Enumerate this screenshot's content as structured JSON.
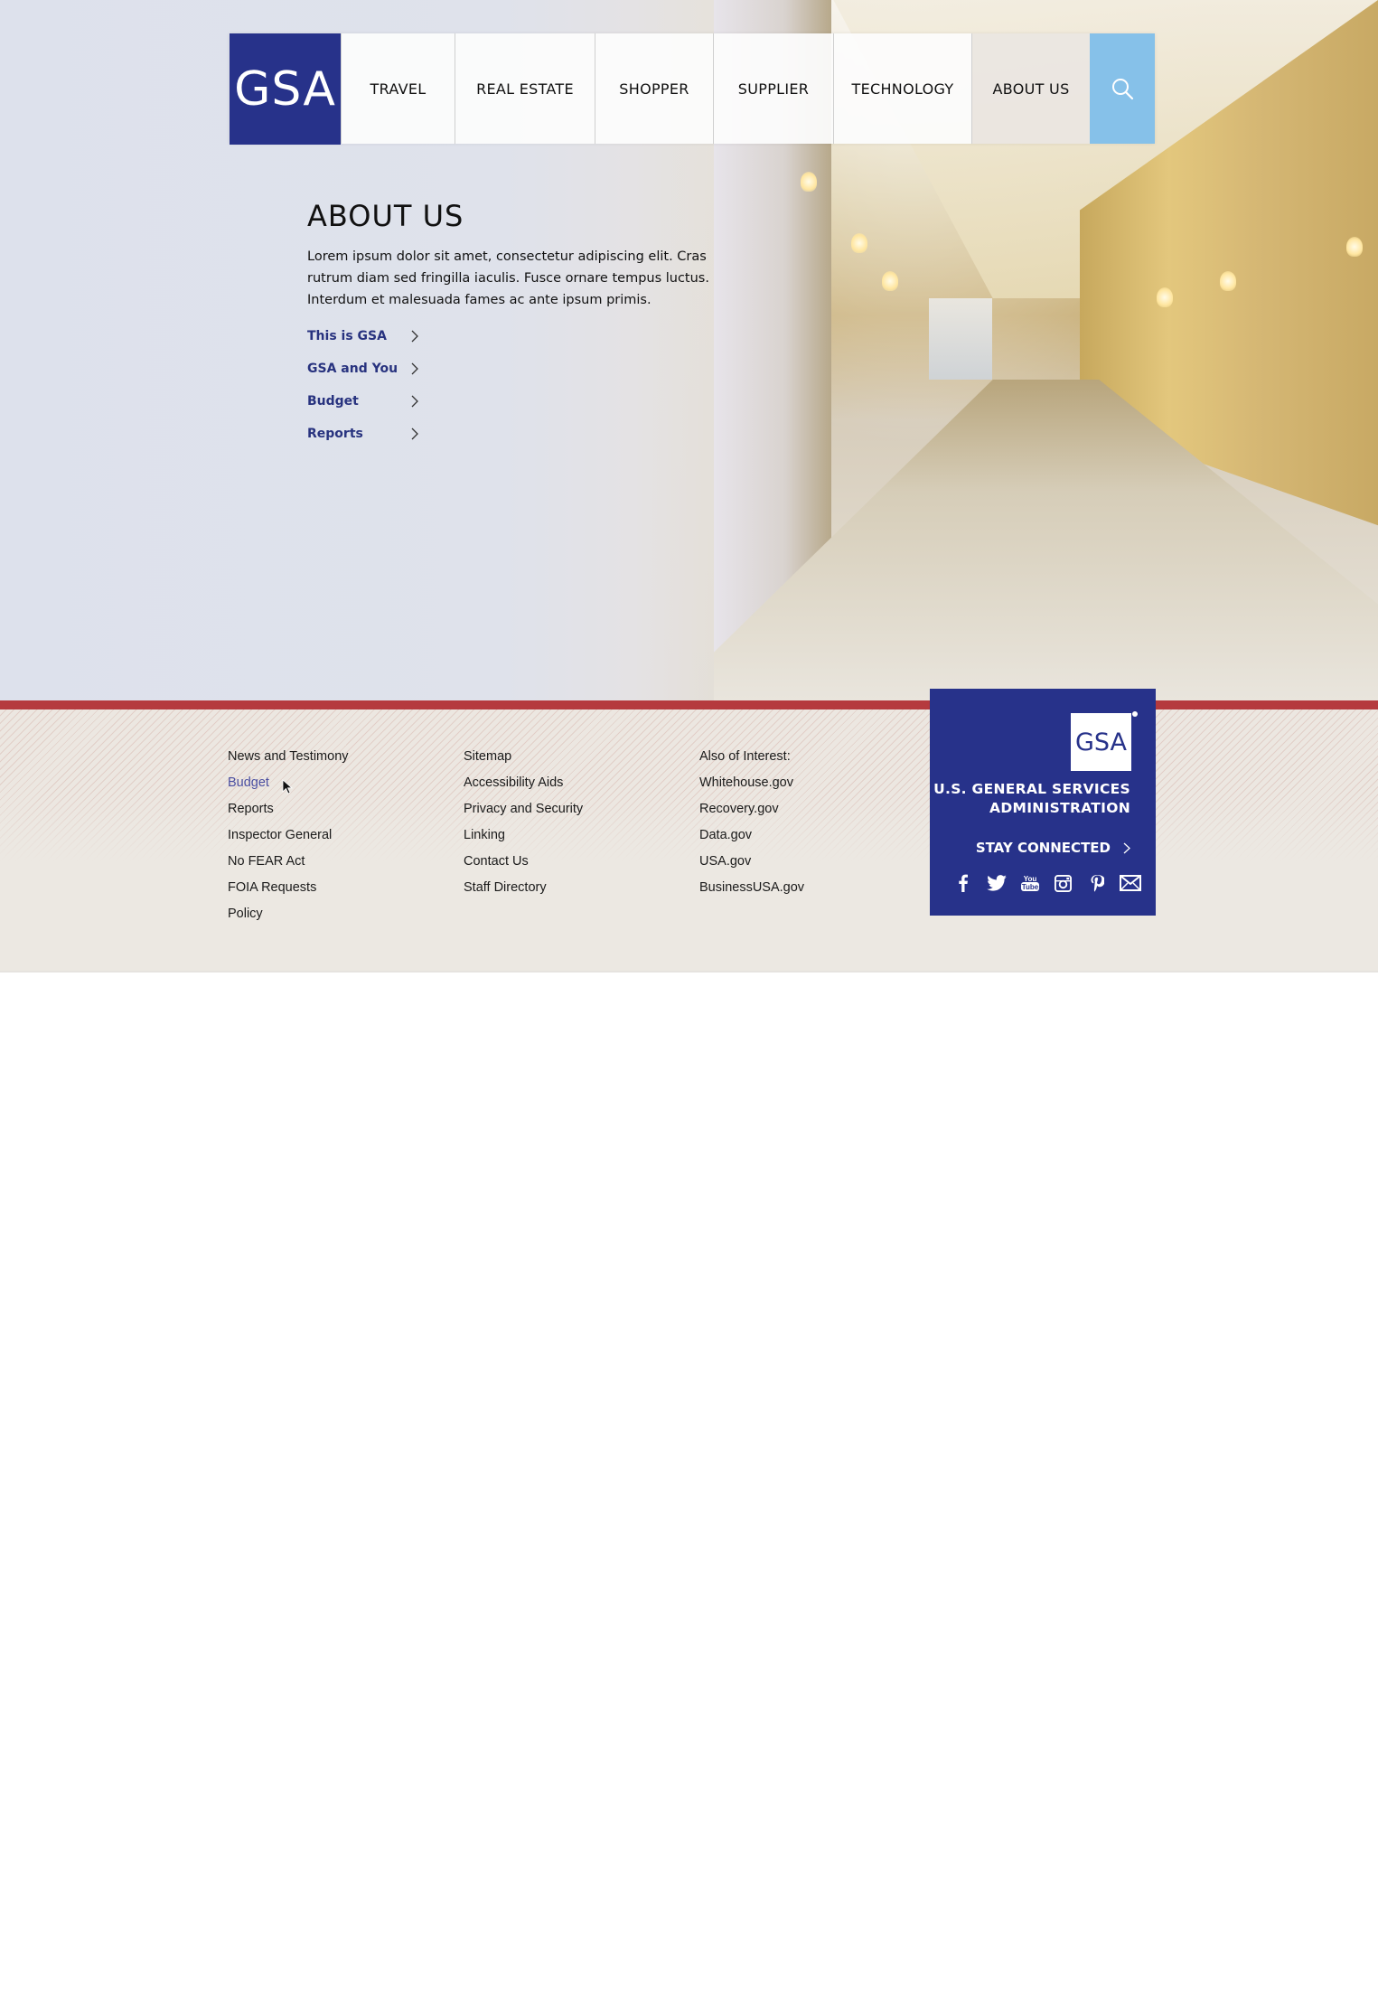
{
  "logo": {
    "text": "GSA"
  },
  "nav": {
    "items": [
      {
        "label": "TRAVEL"
      },
      {
        "label": "REAL ESTATE"
      },
      {
        "label": "SHOPPER"
      },
      {
        "label": "SUPPLIER"
      },
      {
        "label": "TECHNOLOGY"
      },
      {
        "label": "ABOUT US",
        "active": true
      }
    ],
    "search_icon": "search-icon"
  },
  "about": {
    "title": "ABOUT US",
    "body": "Lorem ipsum dolor sit amet, consectetur adipiscing elit. Cras rutrum diam sed fringilla iaculis. Fusce ornare tempus luctus. Interdum et malesuada fames ac ante ipsum primis.",
    "links": [
      {
        "label": "This is GSA"
      },
      {
        "label": "GSA and You"
      },
      {
        "label": "Budget"
      },
      {
        "label": "Reports"
      }
    ]
  },
  "footer": {
    "col1": [
      "News and Testimony",
      "Budget",
      "Reports",
      "Inspector General",
      "No FEAR Act",
      "FOIA Requests",
      "Policy"
    ],
    "col2": [
      "Sitemap",
      "Accessibility Aids",
      "Privacy and Security",
      "Linking",
      "Contact Us",
      "Staff Directory"
    ],
    "col3_heading": "Also of Interest:",
    "col3": [
      "Whitehouse.gov",
      "Recovery.gov",
      "Data.gov",
      "USA.gov",
      "BusinessUSA.gov"
    ],
    "active_link": "Budget"
  },
  "gsa_box": {
    "logo_text": "GSA",
    "name_line1": "U.S. GENERAL SERVICES",
    "name_line2": "ADMINISTRATION",
    "stay_connected": "STAY CONNECTED",
    "social_icons": [
      "facebook-icon",
      "twitter-icon",
      "youtube-icon",
      "instagram-icon",
      "pinterest-icon",
      "email-icon"
    ]
  },
  "colors": {
    "brand_blue": "#27328a",
    "search_blue": "#86c1e9",
    "footer_red": "#b53a3e",
    "link_blue": "#28337f"
  }
}
